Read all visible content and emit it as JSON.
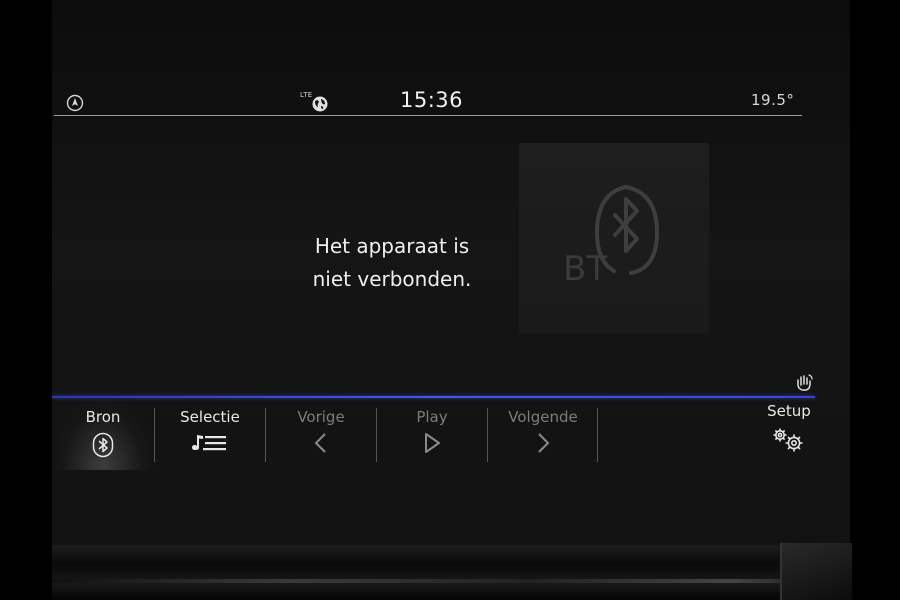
{
  "status_bar": {
    "nav_icon": "navigation-compass-icon",
    "network_label": "LTE",
    "network_icon": "globe-icon",
    "time": "15:36",
    "temperature": "19.5°"
  },
  "main": {
    "message_line1": "Het apparaat is",
    "message_line2": "niet verbonden.",
    "artwork_label": "BT",
    "artwork_icon": "bluetooth-icon",
    "gesture_icon": "hand-gesture-icon"
  },
  "bottom_bar": {
    "items": [
      {
        "label": "Bron",
        "icon": "bluetooth-icon",
        "active": true
      },
      {
        "label": "Selectie",
        "icon": "playlist-icon",
        "active": false
      },
      {
        "label": "Vorige",
        "icon": "chevron-left-icon",
        "enabled": false
      },
      {
        "label": "Play",
        "icon": "play-icon",
        "enabled": false
      },
      {
        "label": "Volgende",
        "icon": "chevron-right-icon",
        "enabled": false
      },
      {
        "label": "Setup",
        "icon": "gears-icon",
        "enabled": true
      }
    ]
  },
  "colors": {
    "accent_blue": "#4050d0",
    "text": "#efefef",
    "disabled_text": "#7c7c7c",
    "screen_bg": "#121212"
  }
}
